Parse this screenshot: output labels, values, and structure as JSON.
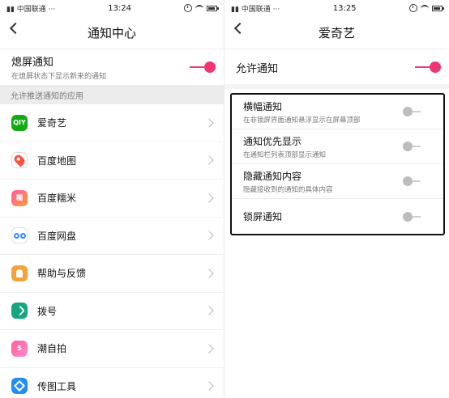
{
  "left": {
    "status": {
      "carrier": "中国联通",
      "dots": "···",
      "time": "13:24"
    },
    "title": "通知中心",
    "screen_notice": {
      "label": "熄屏通知",
      "subtitle": "在熄屏状态下显示新来的通知"
    },
    "section": "允许推送通知的应用",
    "apps": [
      {
        "name": "爱奇艺",
        "icon": "iqiyi-app-icon",
        "badge": "QIY"
      },
      {
        "name": "百度地图",
        "icon": "baidu-map-app-icon"
      },
      {
        "name": "百度糯米",
        "icon": "baidu-nuomi-app-icon",
        "badge": "糯"
      },
      {
        "name": "百度网盘",
        "icon": "baidu-netdisk-app-icon"
      },
      {
        "name": "帮助与反馈",
        "icon": "help-feedback-app-icon"
      },
      {
        "name": "拨号",
        "icon": "dialer-app-icon"
      },
      {
        "name": "潮自拍",
        "icon": "chao-selfie-app-icon",
        "badge": "S"
      },
      {
        "name": "传图工具",
        "icon": "image-transfer-app-icon"
      }
    ]
  },
  "right": {
    "status": {
      "carrier": "中国联通",
      "dots": "···",
      "time": "13:25"
    },
    "title": "爱奇艺",
    "allow_notice": "允许通知",
    "settings": [
      {
        "label": "横幅通知",
        "subtitle": "在非锁屏界面通知悬浮显示在屏幕顶部"
      },
      {
        "label": "通知优先显示",
        "subtitle": "在通知栏列表顶部显示通知"
      },
      {
        "label": "隐藏通知内容",
        "subtitle": "隐藏接收到的通知的具体内容"
      },
      {
        "label": "锁屏通知",
        "subtitle": ""
      }
    ]
  },
  "colors": {
    "accent": "#f03476",
    "section": "#ececec"
  }
}
